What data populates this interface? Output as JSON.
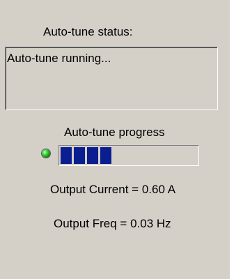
{
  "status": {
    "label": "Auto-tune status:",
    "text": "Auto-tune running..."
  },
  "progress": {
    "label": "Auto-tune progress",
    "fraction": 0.42,
    "indicator_icon": "status-led-icon",
    "indicator_color": "#2fbf2f",
    "bar_color": "#0a1e8f"
  },
  "output": {
    "current": "Output Current = 0.60 A",
    "freq": "Output Freq = 0.03 Hz"
  }
}
